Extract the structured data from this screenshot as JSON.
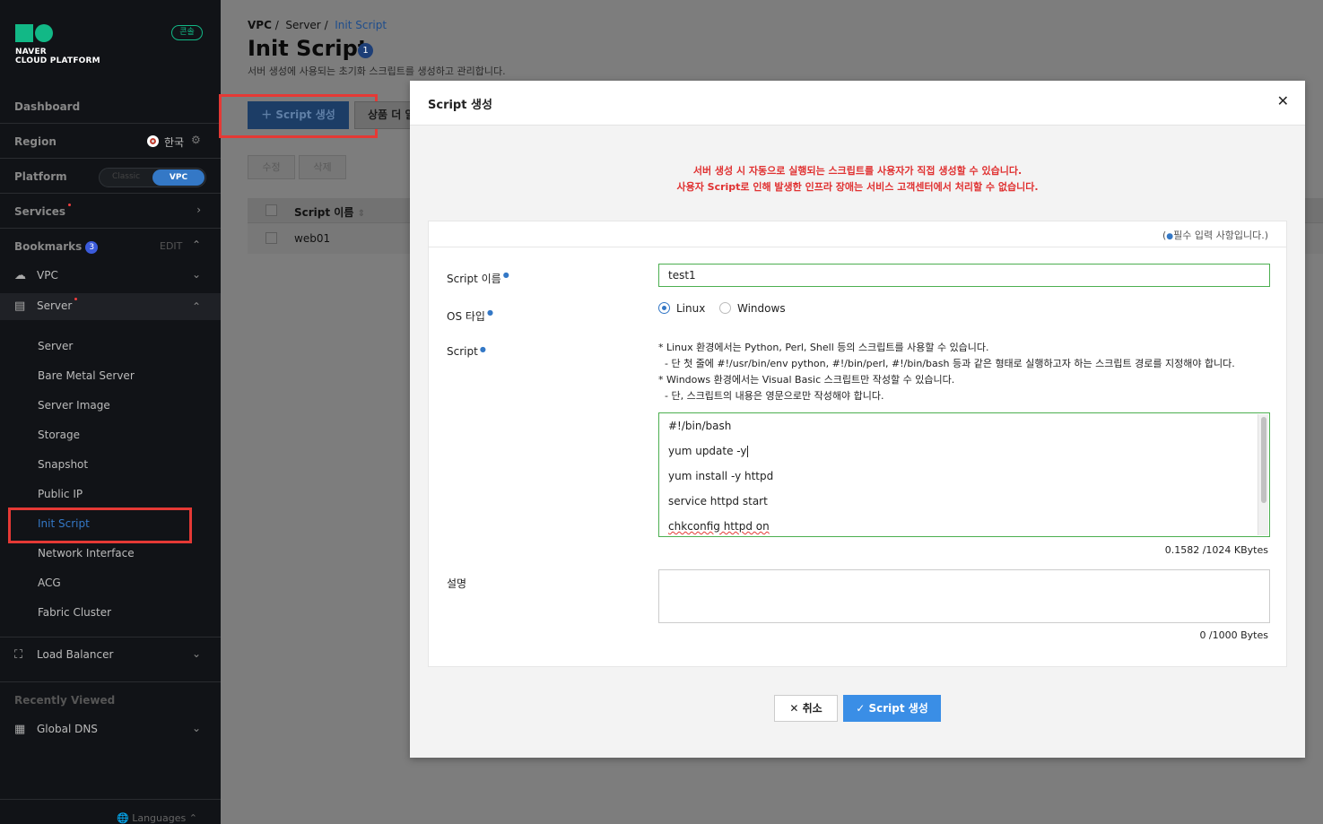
{
  "sidebar": {
    "brand_line1": "NAVER",
    "brand_line2": "CLOUD PLATFORM",
    "console_badge": "콘솔",
    "dashboard": "Dashboard",
    "region_label": "Region",
    "region_value": "한국",
    "platform_label": "Platform",
    "platform_classic": "Classic",
    "platform_vpc": "VPC",
    "services_label": "Services",
    "bookmarks_label": "Bookmarks",
    "bookmarks_count": "3",
    "edit_label": "EDIT",
    "vpc_label": "VPC",
    "server_label": "Server",
    "server_subitems": [
      "Server",
      "Bare Metal Server",
      "Server Image",
      "Storage",
      "Snapshot",
      "Public IP",
      "Init Script",
      "Network Interface",
      "ACG",
      "Fabric Cluster"
    ],
    "load_balancer_label": "Load Balancer",
    "recently_viewed_label": "Recently Viewed",
    "global_dns_label": "Global DNS",
    "languages_label": "Languages"
  },
  "main": {
    "breadcrumb": [
      "VPC",
      "Server",
      "Init Script"
    ],
    "title": "Init Script",
    "title_badge": "1",
    "subtitle": "서버 생성에 사용되는 초기화 스크립트를 생성하고 관리합니다.",
    "create_button": "Script 생성",
    "more_button": "상품 더 알",
    "edit_button": "수정",
    "delete_button": "삭제",
    "table_header": "Script 이름",
    "table_rows": [
      "web01"
    ]
  },
  "modal": {
    "title": "Script 생성",
    "warning_line1": "서버 생성 시 자동으로 실행되는 스크립트를 사용자가 직접 생성할 수 있습니다.",
    "warning_line2": "사용자 Script로 인해 발생한 인프라 장애는 서비스 고객센터에서 처리할 수 없습니다.",
    "required_note_prefix": "(",
    "required_note_text": "필수 입력 사항입니다.)",
    "script_name_label": "Script 이름",
    "script_name_value": "test1",
    "os_type_label": "OS 타입",
    "os_options": [
      "Linux",
      "Windows"
    ],
    "os_selected": "Linux",
    "script_label": "Script",
    "hint_lines": [
      "* Linux 환경에서는 Python, Perl, Shell 등의 스크립트를 사용할 수 있습니다.",
      "  - 단 첫 줄에 #!/usr/bin/env python, #!/bin/perl, #!/bin/bash 등과 같은 형태로 실행하고자 하는 스크립트 경로를 지정해야 합니다.",
      "* Windows 환경에서는 Visual Basic 스크립트만 작성할 수 있습니다.",
      "  - 단, 스크립트의 내용은 영문으로만 작성해야 합니다."
    ],
    "script_lines": [
      "#!/bin/bash",
      "yum update -y",
      "yum install -y httpd",
      "service httpd start",
      "chkconfig httpd on"
    ],
    "script_counter": "0.1582 /1024 KBytes",
    "description_label": "설명",
    "description_value": "",
    "description_counter": "0 /1000 Bytes",
    "cancel_button": "취소",
    "submit_button": "Script 생성"
  },
  "colors": {
    "accent": "#3478c6",
    "brand_green": "#12b886",
    "warning_red": "#e03131",
    "highlight_red": "#e53935"
  }
}
